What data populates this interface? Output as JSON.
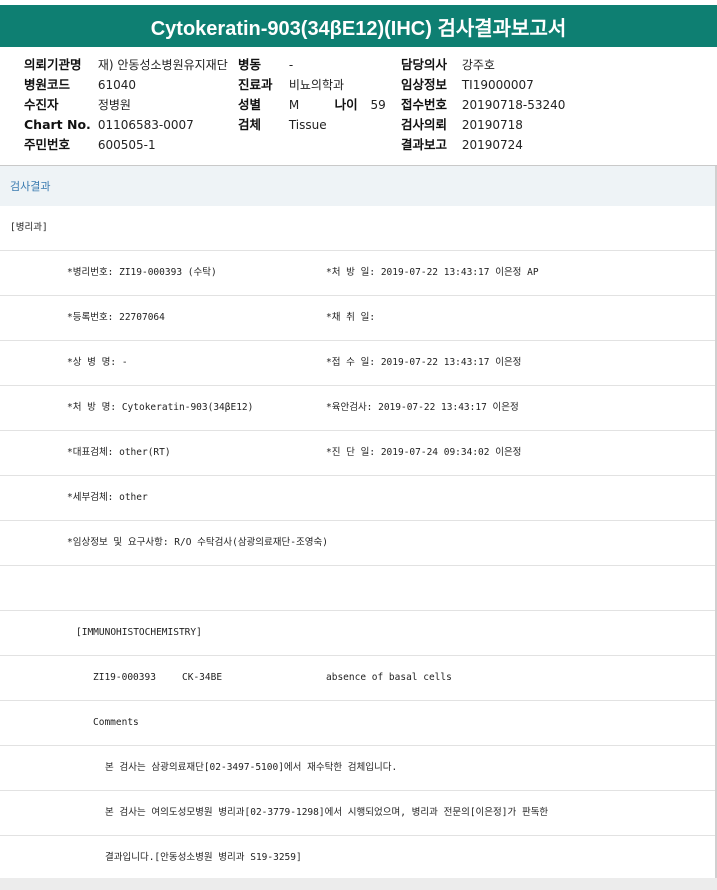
{
  "title": "Cytokeratin-903(34βE12)(IHC) 검사결과보고서",
  "header": {
    "col1": [
      {
        "label": "의뢰기관명",
        "value": "재) 안동성소병원유지재단"
      },
      {
        "label": "병원코드",
        "value": "61040"
      },
      {
        "label": "수진자",
        "value": "정병원"
      },
      {
        "label": "Chart No.",
        "value": "01106583-0007"
      },
      {
        "label": "주민번호",
        "value": "600505-1"
      }
    ],
    "col2": {
      "ward_label": "병동",
      "ward_value": "-",
      "dept_label": "진료과",
      "dept_value": "비뇨의학과",
      "sex_label": "성별",
      "sex_value": "M",
      "age_label": "나이",
      "age_value": "59",
      "specimen_label": "검체",
      "specimen_value": "Tissue"
    },
    "col3": [
      {
        "label": "담당의사",
        "value": "강주호"
      },
      {
        "label": "임상정보",
        "value": "TI19000007"
      },
      {
        "label": "접수번호",
        "value": "20190718-53240"
      },
      {
        "label": "검사의뢰",
        "value": "20190718"
      },
      {
        "label": "결과보고",
        "value": "20190724"
      }
    ]
  },
  "section_title": "검사결과",
  "rows": [
    {
      "left": "[병리과]",
      "right": ""
    },
    {
      "left": "*병리번호: ZI19-000393 (수탁)",
      "right": "*처 방 일: 2019-07-22 13:43:17  이은정 AP"
    },
    {
      "left": "*등록번호: 22707064",
      "right": "*채 취 일:"
    },
    {
      "left": "*상 병 명: -",
      "right": "*접 수 일: 2019-07-22 13:43:17  이은정"
    },
    {
      "left": "*처 방 명: Cytokeratin-903(34βE12)",
      "right": "*육안검사: 2019-07-22 13:43:17  이은정"
    },
    {
      "left": "*대표검체: other(RT)",
      "right": "*진 단 일: 2019-07-24 09:34:02  이은정"
    },
    {
      "left": "*세부검체: other",
      "right": ""
    },
    {
      "left": "*임상정보 및 요구사항: R/O 수탁검사(삼광의료재단-조영숙)",
      "right": ""
    },
    {
      "left": "",
      "right": ""
    },
    {
      "left": "[IMMUNOHISTOCHEMISTRY]",
      "right": ""
    },
    {
      "left": "ZI19-000393",
      "mid": "CK-34BE",
      "right": "absence of basal cells"
    },
    {
      "left": "Comments",
      "right": ""
    },
    {
      "left": "본 검사는 삼광의료재단[02-3497-5100]에서 재수탁한 검체입니다.",
      "right": ""
    },
    {
      "left": "본 검사는 여의도성모병원 병리과[02-3779-1298]에서 시행되었으며, 병리과 전문의[이은정]가 판독한",
      "right": ""
    },
    {
      "left": "결과입니다.[안동성소병원 병리과 S19-3259]",
      "right": ""
    }
  ]
}
